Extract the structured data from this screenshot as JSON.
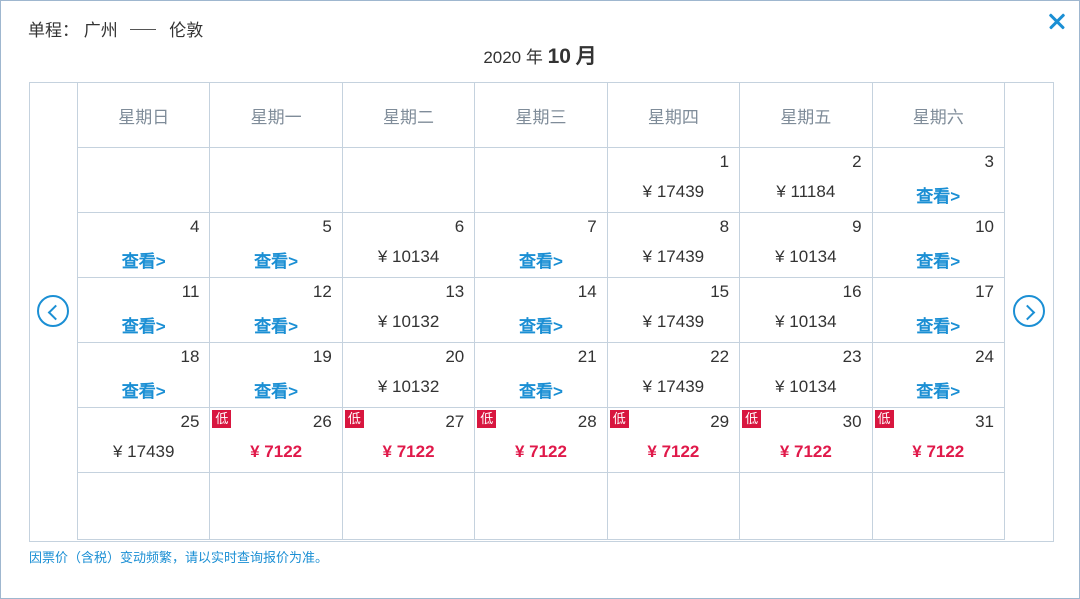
{
  "header": {
    "trip_type": "单程：",
    "origin": "广州",
    "destination": "伦敦"
  },
  "month_title": {
    "year_label": "2020 年",
    "month": "10",
    "month_suffix": "月"
  },
  "weekdays": [
    "星期日",
    "星期一",
    "星期二",
    "星期三",
    "星期四",
    "星期五",
    "星期六"
  ],
  "view_label": "查看>",
  "low_badge": "低",
  "weeks": [
    [
      {
        "day": ""
      },
      {
        "day": ""
      },
      {
        "day": ""
      },
      {
        "day": ""
      },
      {
        "day": "1",
        "price": "¥ 17439"
      },
      {
        "day": "2",
        "price": "¥ 11184"
      },
      {
        "day": "3",
        "view": true
      }
    ],
    [
      {
        "day": "4",
        "view": true
      },
      {
        "day": "5",
        "view": true
      },
      {
        "day": "6",
        "price": "¥ 10134"
      },
      {
        "day": "7",
        "view": true
      },
      {
        "day": "8",
        "price": "¥ 17439"
      },
      {
        "day": "9",
        "price": "¥ 10134"
      },
      {
        "day": "10",
        "view": true
      }
    ],
    [
      {
        "day": "11",
        "view": true
      },
      {
        "day": "12",
        "view": true
      },
      {
        "day": "13",
        "price": "¥ 10132"
      },
      {
        "day": "14",
        "view": true
      },
      {
        "day": "15",
        "price": "¥ 17439"
      },
      {
        "day": "16",
        "price": "¥ 10134"
      },
      {
        "day": "17",
        "view": true
      }
    ],
    [
      {
        "day": "18",
        "view": true
      },
      {
        "day": "19",
        "view": true
      },
      {
        "day": "20",
        "price": "¥ 10132"
      },
      {
        "day": "21",
        "view": true
      },
      {
        "day": "22",
        "price": "¥ 17439"
      },
      {
        "day": "23",
        "price": "¥ 10134"
      },
      {
        "day": "24",
        "view": true
      }
    ],
    [
      {
        "day": "25",
        "price": "¥ 17439"
      },
      {
        "day": "26",
        "price": "¥ 7122",
        "low": true
      },
      {
        "day": "27",
        "price": "¥ 7122",
        "low": true
      },
      {
        "day": "28",
        "price": "¥ 7122",
        "low": true
      },
      {
        "day": "29",
        "price": "¥ 7122",
        "low": true
      },
      {
        "day": "30",
        "price": "¥ 7122",
        "low": true
      },
      {
        "day": "31",
        "price": "¥ 7122",
        "low": true
      }
    ],
    [
      {
        "day": ""
      },
      {
        "day": ""
      },
      {
        "day": ""
      },
      {
        "day": ""
      },
      {
        "day": ""
      },
      {
        "day": ""
      },
      {
        "day": ""
      }
    ]
  ],
  "footnote": "因票价（含税）变动频繁，请以实时查询报价为准。",
  "colors": {
    "accent": "#1b8fd4",
    "low_price": "#e0194a",
    "badge_bg": "#d8163f",
    "grid_border": "#c5d2de"
  }
}
